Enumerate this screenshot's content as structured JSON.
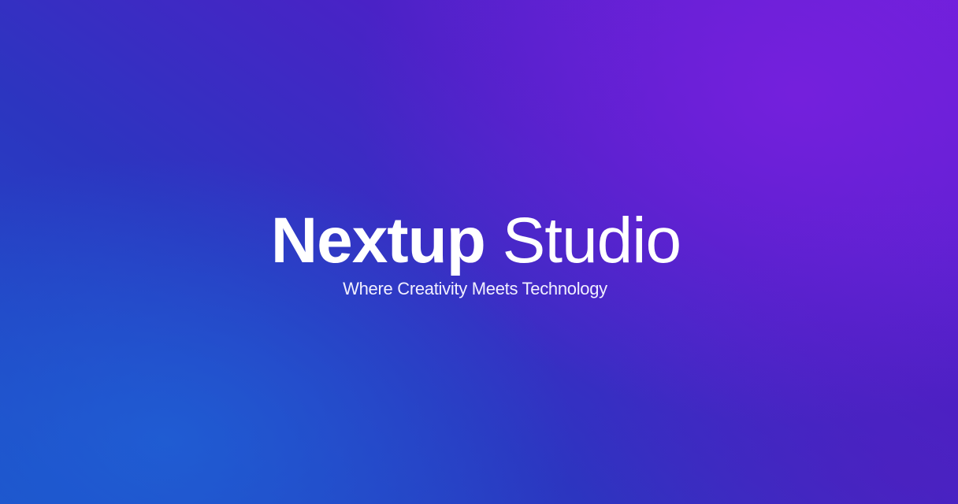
{
  "hero": {
    "title_bold": "Nextup",
    "title_light": "Studio",
    "tagline": "Where Creativity Meets Technology"
  },
  "colors": {
    "background_start": "#1d4fc8",
    "background_mid": "#3a2ac4",
    "background_end": "#6a1fd8",
    "text": "#ffffff"
  }
}
